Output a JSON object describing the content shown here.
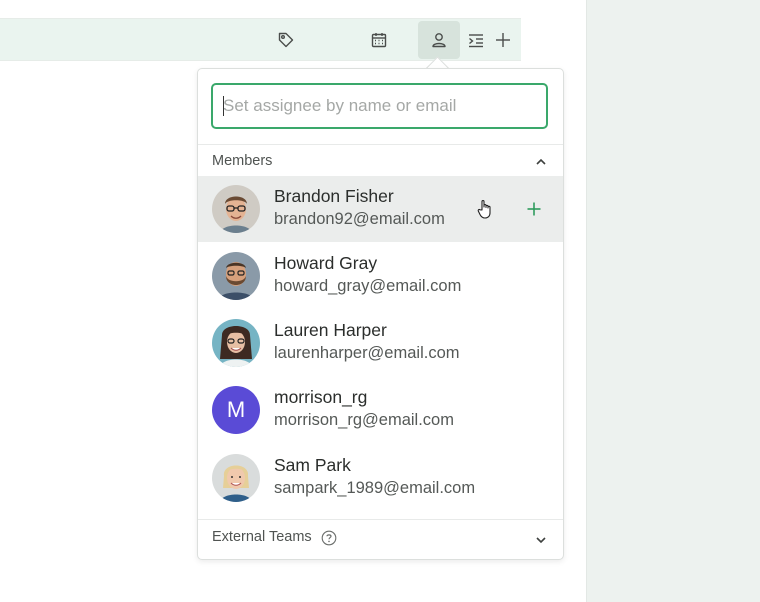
{
  "toolbar": {
    "icons": [
      "tag-icon",
      "calendar-icon",
      "user-icon",
      "indent-icon",
      "plus-icon"
    ],
    "active": "user-icon"
  },
  "assignee_popover": {
    "search": {
      "placeholder": "Set assignee by name or email",
      "value": ""
    },
    "members_section": {
      "label": "Members",
      "expanded": true
    },
    "members": [
      {
        "name": "Brandon Fisher",
        "email": "brandon92@email.com",
        "avatar": "photo"
      },
      {
        "name": "Howard Gray",
        "email": "howard_gray@email.com",
        "avatar": "photo"
      },
      {
        "name": "Lauren Harper",
        "email": "laurenharper@email.com",
        "avatar": "photo"
      },
      {
        "name": "morrison_rg",
        "email": "morrison_rg@email.com",
        "avatar": "M"
      },
      {
        "name": "Sam Park",
        "email": "sampark_1989@email.com",
        "avatar": "photo"
      }
    ],
    "external_teams": {
      "label": "External Teams",
      "expanded": false
    }
  },
  "colors": {
    "accent": "#2e9b5d",
    "focus_border": "#3aa86b",
    "toolbar_bg": "#eaf4ef",
    "initial_avatar_bg": "#5a4bd6"
  }
}
